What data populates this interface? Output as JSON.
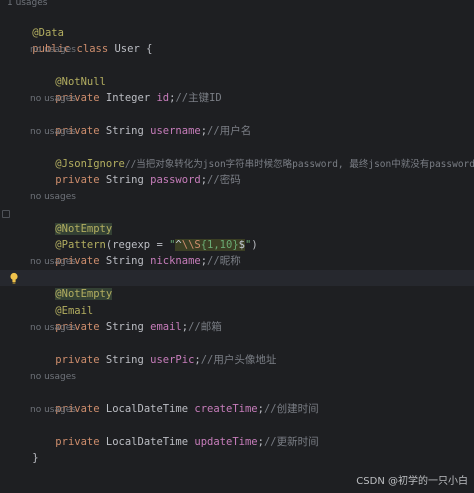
{
  "editor": {
    "top_hint": "1 usages",
    "lines": {
      "data_ann": "@Data",
      "class_kw": "public class",
      "class_name": " User {",
      "hint_1": "no usages",
      "notnull_ann": "@NotNull",
      "id_kw": "private",
      "id_type": " Integer ",
      "id_field": "id",
      "id_rest": ";",
      "id_comment": "//主键ID",
      "hint_2": "no usages",
      "username_kw": "private",
      "username_type": " String ",
      "username_field": "username",
      "username_rest": ";",
      "username_comment": "//用户名",
      "hint_3": "no usages",
      "jsonignore_ann": "@JsonIgnore",
      "jsonignore_comment": "//当把对象转化为json字符串时候忽略password, 最终json中就没有password",
      "password_kw": "private",
      "password_type": " String ",
      "password_field": "password",
      "password_rest": ";",
      "password_comment": "//密码",
      "hint_4": "no usages",
      "notempty_ann_1": "@NotEmpty",
      "pattern_ann": "@Pattern",
      "pattern_open": "(regexp = ",
      "pattern_q1": "\"",
      "pattern_rx1": "^",
      "pattern_esc": "\\\\S",
      "pattern_rx2": "{1,10}",
      "pattern_rx3": "$",
      "pattern_q2": "\"",
      "pattern_close": ")",
      "nickname_kw": "private",
      "nickname_type": " String ",
      "nickname_field": "nickname",
      "nickname_rest": ";",
      "nickname_comment": "//昵称",
      "hint_5": "no usages",
      "notempty_ann_2": "@NotEmpty",
      "email_ann": "@Email",
      "email_kw": "private",
      "email_type": " String ",
      "email_field": "email",
      "email_rest": ";",
      "email_comment": "//邮箱",
      "hint_6": "no usages",
      "userpic_kw": "private",
      "userpic_type": " String ",
      "userpic_field": "userPic",
      "userpic_rest": ";",
      "userpic_comment": "//用户头像地址",
      "hint_7": "no usages",
      "create_kw": "private",
      "create_type": " LocalDateTime ",
      "create_field": "createTime",
      "create_rest": ";",
      "create_comment": "//创建时间",
      "hint_8": "no usages",
      "update_kw": "private",
      "update_type": " LocalDateTime ",
      "update_field": "updateTime",
      "update_rest": ";",
      "update_comment": "//更新时间",
      "closing": "}"
    }
  },
  "watermark": "CSDN @初学的一只小白",
  "colors": {
    "background": "#1e1f22",
    "annotation": "#b3ae60",
    "keyword": "#cf8e6d",
    "field": "#c77dbb",
    "comment": "#7a7e85",
    "string": "#6aab73",
    "hint": "#6f737a"
  },
  "icons": {
    "intention": "lightbulb-icon",
    "fold": "fold-marker-icon"
  }
}
